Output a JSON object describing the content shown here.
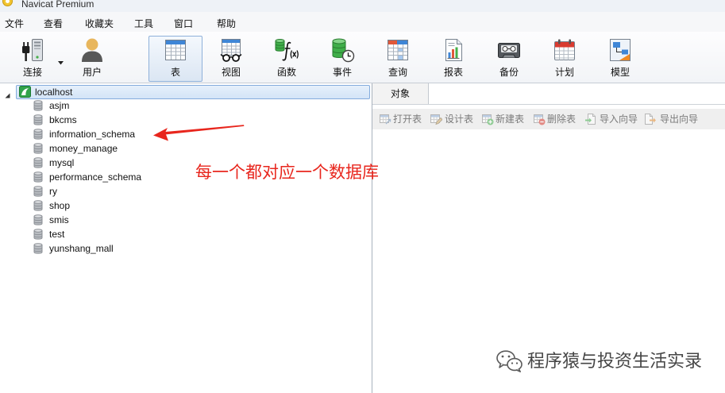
{
  "window": {
    "title": "Navicat Premium",
    "icon": "navicat-logo-icon"
  },
  "menu": [
    {
      "label": "文件"
    },
    {
      "label": "查看"
    },
    {
      "label": "收藏夹"
    },
    {
      "label": "工具"
    },
    {
      "label": "窗口"
    },
    {
      "label": "帮助"
    }
  ],
  "toolbar": {
    "items": [
      {
        "label": "连接",
        "icon": "connection-icon",
        "has_dropdown": true
      },
      {
        "label": "用户",
        "icon": "user-icon"
      },
      {
        "label": "表",
        "icon": "table-icon",
        "selected": true
      },
      {
        "label": "视图",
        "icon": "view-icon"
      },
      {
        "label": "函数",
        "icon": "function-icon"
      },
      {
        "label": "事件",
        "icon": "event-icon"
      },
      {
        "label": "查询",
        "icon": "query-icon"
      },
      {
        "label": "报表",
        "icon": "report-icon"
      },
      {
        "label": "备份",
        "icon": "backup-icon"
      },
      {
        "label": "计划",
        "icon": "schedule-icon"
      },
      {
        "label": "模型",
        "icon": "model-icon"
      }
    ]
  },
  "navigator": {
    "connection": {
      "label": "localhost",
      "icon": "mysql-connection-icon",
      "expanded": true,
      "selected": true
    },
    "databases": [
      {
        "name": "asjm"
      },
      {
        "name": "bkcms"
      },
      {
        "name": "information_schema"
      },
      {
        "name": "money_manage"
      },
      {
        "name": "mysql"
      },
      {
        "name": "performance_schema"
      },
      {
        "name": "ry"
      },
      {
        "name": "shop"
      },
      {
        "name": "smis"
      },
      {
        "name": "test"
      },
      {
        "name": "yunshang_mall"
      }
    ]
  },
  "object_pane": {
    "tab": "对象",
    "actions": [
      {
        "label": "打开表",
        "icon": "open-table-icon",
        "enabled": false
      },
      {
        "label": "设计表",
        "icon": "design-table-icon",
        "enabled": false
      },
      {
        "label": "新建表",
        "icon": "new-table-icon",
        "enabled": false
      },
      {
        "label": "删除表",
        "icon": "delete-table-icon",
        "enabled": false
      },
      {
        "label": "导入向导",
        "icon": "import-wizard-icon",
        "enabled": false
      },
      {
        "label": "导出向导",
        "icon": "export-wizard-icon",
        "enabled": false
      }
    ]
  },
  "annotation": {
    "text": "每一个都对应一个数据库",
    "color": "#e8261d"
  },
  "watermark": {
    "text": "程序猿与投资生活实录",
    "icon": "wechat-icon"
  },
  "colors": {
    "selection": "#d3e4f7",
    "selection_border": "#84acdd",
    "accent_blue": "#3f86d6",
    "db_green": "#3fae49"
  }
}
